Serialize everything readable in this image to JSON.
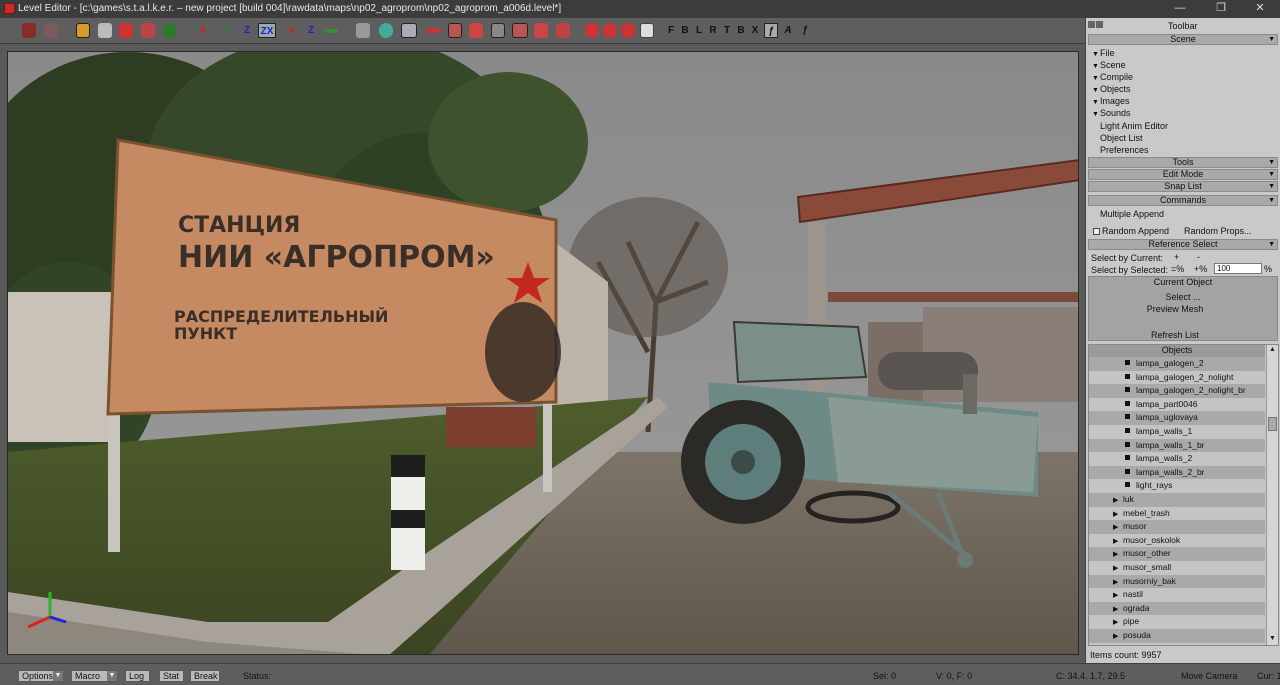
{
  "window": {
    "title": "Level Editor - [c:\\games\\s.t.a.l.k.e.r. – new project [build 004]\\rawdata\\maps\\np02_agroprom\\np02_agroprom_a006d.level*]",
    "minimize": "—",
    "maximize": "❐",
    "close": "✕"
  },
  "toolbar": {
    "axis_letters": [
      "X",
      "Y",
      "Z",
      "ZX",
      "X",
      "Z"
    ],
    "view_letters": [
      "F",
      "B",
      "L",
      "R",
      "T",
      "B",
      "X"
    ],
    "icon_names": [
      "undo-icon",
      "redo-icon",
      "select-icon",
      "move-icon",
      "rotate-icon",
      "scale-icon",
      "snap-icon",
      "camera-icon",
      "grid-icon",
      "light-icon",
      "color-icon",
      "texture-icon",
      "box-icon",
      "gear-icon",
      "lock-icon",
      "cut-icon",
      "zoom-icon",
      "render-icon",
      "stop-icon",
      "fill-icon",
      "wireframe-icon"
    ]
  },
  "panel": {
    "toolbar_label": "Toolbar",
    "scene_header": "Scene",
    "menu": [
      "File",
      "Scene",
      "Compile",
      "Objects",
      "Images",
      "Sounds"
    ],
    "plain_items": [
      "Light Anim Editor",
      "Object List",
      "Preferences"
    ],
    "tools_header": "Tools",
    "edit_mode_header": "Edit Mode",
    "snap_list_header": "Snap List",
    "commands_header": "Commands",
    "multiple_append": "Multiple Append",
    "random_append": "Random Append",
    "random_props": "Random Props...",
    "reference_select_header": "Reference Select",
    "select_by_current": "Select by Current:",
    "select_by_selected": "Select by Selected:",
    "plus": "+",
    "minus": "-",
    "eq_pct": "=%",
    "plus_pct": "+%",
    "percent_value": "100",
    "pct": "%",
    "current_object_header": "Current Object",
    "select_btn": "Select ...",
    "preview_mesh": "Preview Mesh",
    "refresh_list": "Refresh List",
    "objects_header": "Objects",
    "items_count": "Items count: 9957"
  },
  "objects": [
    {
      "label": "lampa_galogen_2",
      "type": "item"
    },
    {
      "label": "lampa_galogen_2_nolight",
      "type": "item"
    },
    {
      "label": "lampa_galogen_2_nolight_br",
      "type": "item"
    },
    {
      "label": "lampa_part0046",
      "type": "item"
    },
    {
      "label": "lampa_uglovaya",
      "type": "item"
    },
    {
      "label": "lampa_walls_1",
      "type": "item"
    },
    {
      "label": "lampa_walls_1_br",
      "type": "item"
    },
    {
      "label": "lampa_walls_2",
      "type": "item"
    },
    {
      "label": "lampa_walls_2_br",
      "type": "item"
    },
    {
      "label": "light_rays",
      "type": "item"
    },
    {
      "label": "luk",
      "type": "folder"
    },
    {
      "label": "mebel_trash",
      "type": "folder"
    },
    {
      "label": "musor",
      "type": "folder"
    },
    {
      "label": "musor_oskolok",
      "type": "folder"
    },
    {
      "label": "musor_other",
      "type": "folder"
    },
    {
      "label": "musor_small",
      "type": "folder"
    },
    {
      "label": "musorniy_bak",
      "type": "folder"
    },
    {
      "label": "nastil",
      "type": "folder"
    },
    {
      "label": "ograda",
      "type": "folder"
    },
    {
      "label": "pipe",
      "type": "folder"
    },
    {
      "label": "posuda",
      "type": "folder"
    }
  ],
  "scene": {
    "sign_line1": "СТАНЦИЯ",
    "sign_line2": "НИИ «АГРОПРОМ»",
    "sign_line3": "РАСПРЕДЕЛИТЕЛЬНЫЙ",
    "sign_line4": "ПУНКТ"
  },
  "statusbar": {
    "options": "Options",
    "macro": "Macro",
    "log": "Log",
    "stat": "Stat",
    "break": "Break",
    "status": "Status:",
    "sel": "Sel: 0",
    "vf": "V: 0, F: 0",
    "coords": "C: 34.4, 1.7, 29.5",
    "mode": "Move Camera",
    "cur": "Cur: 1"
  },
  "colors": {
    "sky": "#8c8c8c",
    "sign": "#c58a62",
    "tractor": "#6e8a86",
    "grass": "#4c5a2a"
  }
}
